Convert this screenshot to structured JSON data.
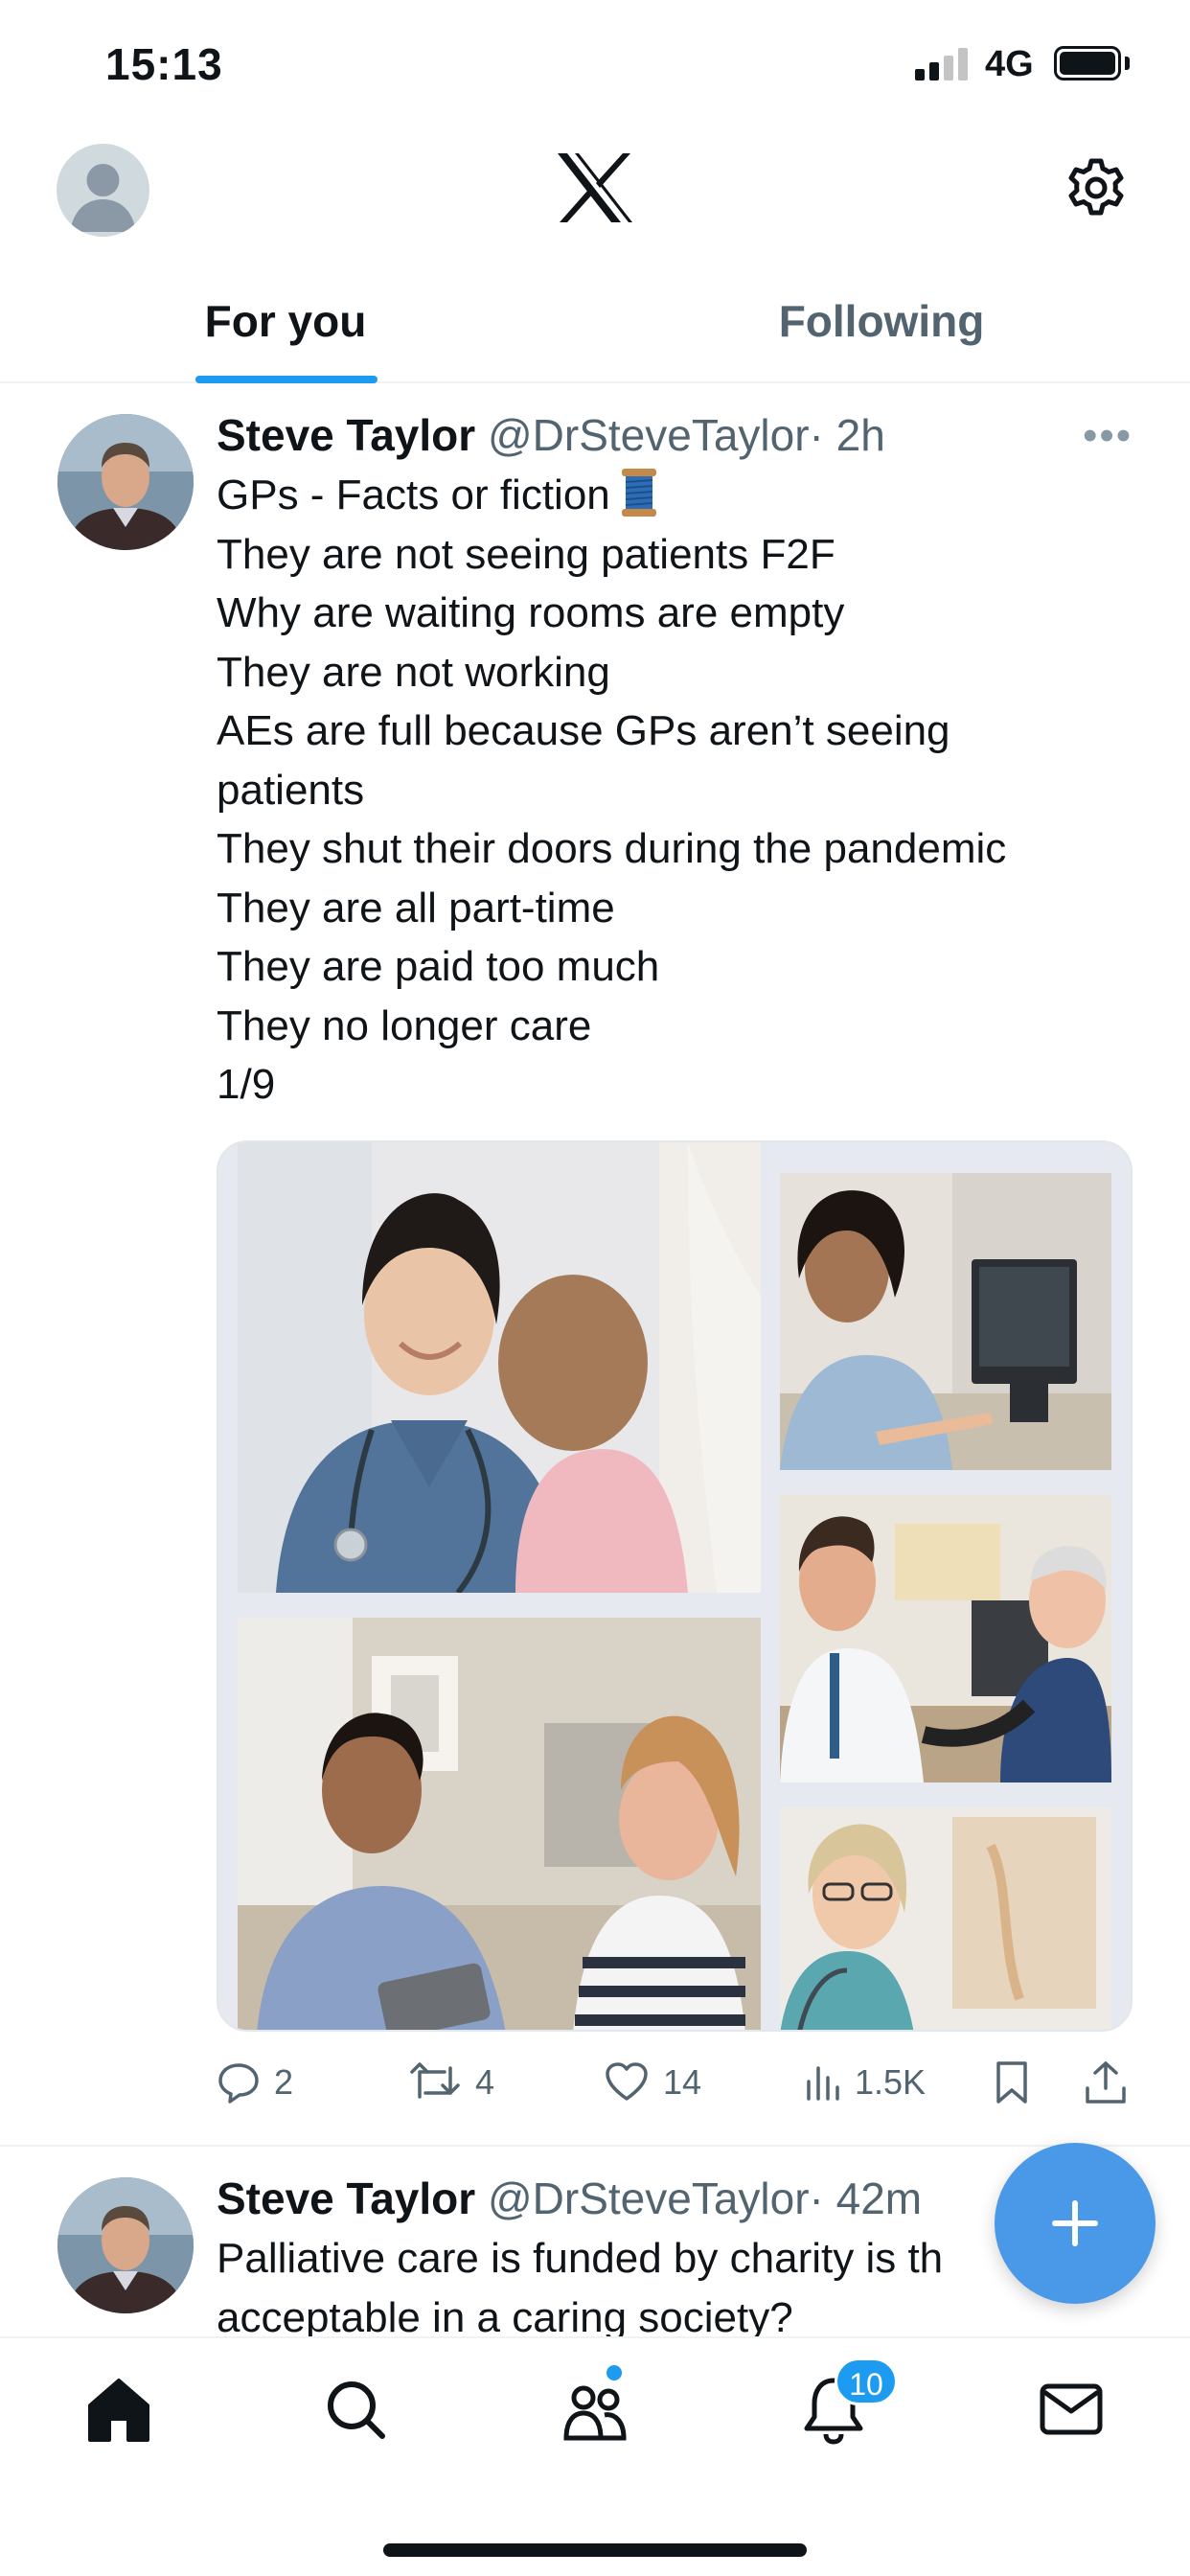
{
  "status_bar": {
    "time": "15:13",
    "network": "4G"
  },
  "header": {
    "tabs": [
      {
        "label": "For you",
        "active": true
      },
      {
        "label": "Following",
        "active": false
      }
    ]
  },
  "tweets": [
    {
      "name": "Steve Taylor",
      "handle": "@DrSteveTaylor",
      "time": "· 2h",
      "lines": [
        "GPs - Facts or fiction",
        "They are not seeing patients F2F",
        "Why are waiting rooms are empty",
        "They are not working",
        "AEs are full because GPs aren’t seeing",
        "patients",
        "They shut their doors during the pandemic",
        "They are all part-time",
        "They are paid too much",
        "They no longer care",
        "1/9"
      ],
      "emoji_icon": "thread-spool-icon",
      "metrics": {
        "replies": "2",
        "reposts": "4",
        "likes": "14",
        "views": "1.5K"
      }
    },
    {
      "name": "Steve Taylor",
      "handle": "@DrSteveTaylor",
      "time": "· 42m",
      "lines": [
        "Palliative care is funded by charity is th",
        "acceptable in a caring society?"
      ]
    }
  ],
  "bottom_nav": {
    "items": [
      "home-icon",
      "search-icon",
      "communities-icon",
      "notifications-icon",
      "messages-icon"
    ],
    "notifications_badge": "10"
  },
  "colors": {
    "accent": "#1d9bf0",
    "text": "#0f1419",
    "secondary": "#536471",
    "fab": "#4a99e9"
  }
}
